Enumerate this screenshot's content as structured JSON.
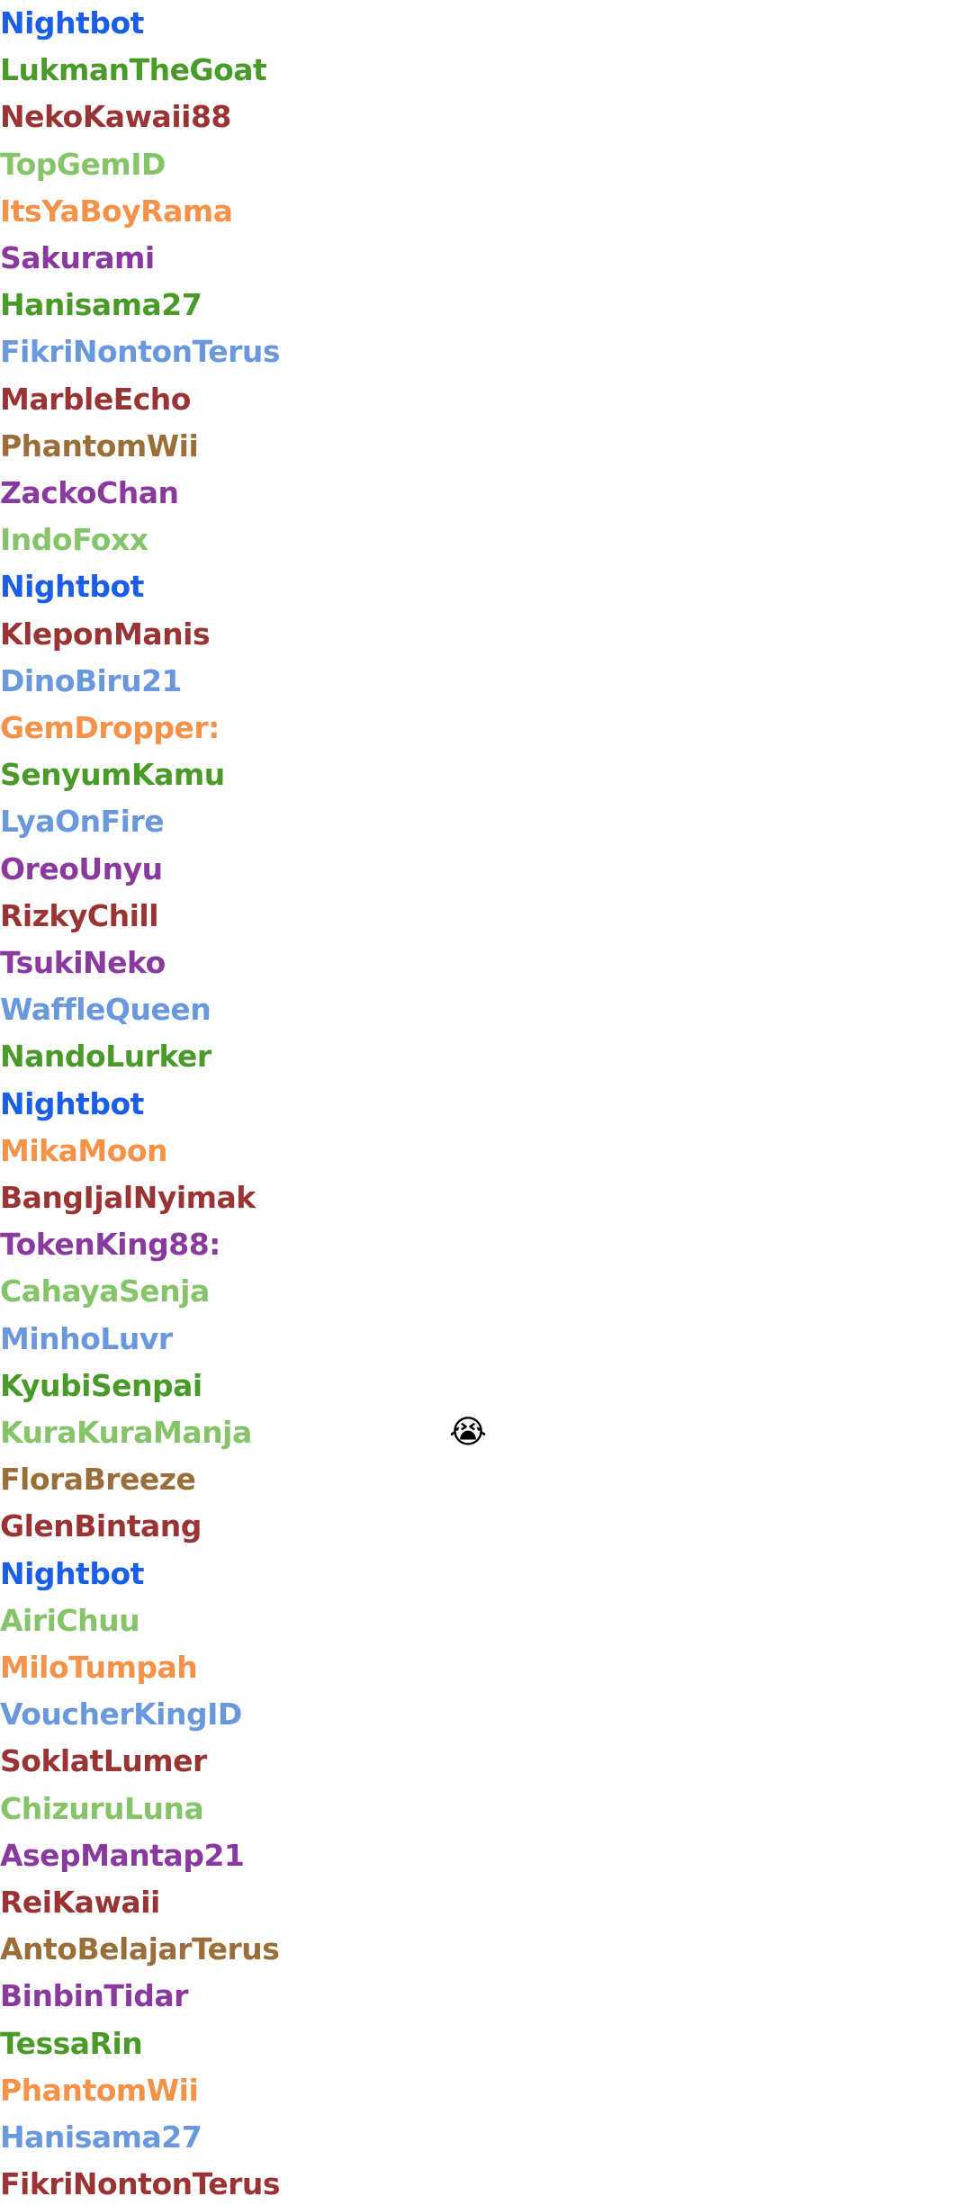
{
  "colors": {
    "nightbot": "#1a5ee8",
    "green": "#4a9a2a",
    "red": "#9a3434",
    "light_green": "#86c46a",
    "orange": "#f5924a",
    "purple": "#8a3a9e",
    "blue": "#6a98dc",
    "brown": "#9a6e38"
  },
  "chat": {
    "rows": [
      {
        "name": "Nightbot",
        "color": "nightbot"
      },
      {
        "name": "LukmanTheGoat",
        "color": "green"
      },
      {
        "name": "NekoKawaii88",
        "color": "red"
      },
      {
        "name": "TopGemID",
        "color": "light_green"
      },
      {
        "name": "ItsYaBoyRama",
        "color": "orange"
      },
      {
        "name": "Sakurami",
        "color": "purple"
      },
      {
        "name": "Hanisama27",
        "color": "green"
      },
      {
        "name": "FikriNontonTerus",
        "color": "blue"
      },
      {
        "name": "MarbleEcho",
        "color": "red"
      },
      {
        "name": "PhantomWii",
        "color": "brown"
      },
      {
        "name": "ZackoChan",
        "color": "purple"
      },
      {
        "name": "IndoFoxx",
        "color": "light_green"
      },
      {
        "name": "Nightbot",
        "color": "nightbot"
      },
      {
        "name": "KleponManis",
        "color": "red"
      },
      {
        "name": "DinoBiru21",
        "color": "blue"
      },
      {
        "name": "GemDropper:",
        "color": "orange"
      },
      {
        "name": "SenyumKamu",
        "color": "green"
      },
      {
        "name": "LyaOnFire",
        "color": "blue"
      },
      {
        "name": "OreoUnyu",
        "color": "purple"
      },
      {
        "name": "RizkyChill",
        "color": "red"
      },
      {
        "name": "TsukiNeko",
        "color": "purple"
      },
      {
        "name": "WaffleQueen",
        "color": "blue"
      },
      {
        "name": "NandoLurker",
        "color": "green"
      },
      {
        "name": "Nightbot",
        "color": "nightbot"
      },
      {
        "name": "MikaMoon",
        "color": "orange"
      },
      {
        "name": "BangIjalNyimak",
        "color": "red"
      },
      {
        "name": "TokenKing88:",
        "color": "purple"
      },
      {
        "name": "CahayaSenja",
        "color": "light_green"
      },
      {
        "name": "MinhoLuvr",
        "color": "blue"
      },
      {
        "name": "KyubiSenpai",
        "color": "green"
      },
      {
        "name": "KuraKuraManja",
        "color": "light_green",
        "emoji": "😭",
        "emoji_icon": "loudly-crying-face-icon"
      },
      {
        "name": "FloraBreeze",
        "color": "brown"
      },
      {
        "name": "GlenBintang",
        "color": "red"
      },
      {
        "name": "Nightbot",
        "color": "nightbot"
      },
      {
        "name": "AiriChuu",
        "color": "light_green"
      },
      {
        "name": "MiloTumpah",
        "color": "orange"
      },
      {
        "name": "VoucherKingID",
        "color": "blue"
      },
      {
        "name": "SoklatLumer",
        "color": "red"
      },
      {
        "name": "ChizuruLuna",
        "color": "light_green"
      },
      {
        "name": "AsepMantap21",
        "color": "purple"
      },
      {
        "name": "ReiKawaii",
        "color": "red"
      },
      {
        "name": "AntoBelajarTerus",
        "color": "brown"
      },
      {
        "name": "BinbinTidar",
        "color": "purple"
      },
      {
        "name": "TessaRin",
        "color": "green"
      },
      {
        "name": "PhantomWii",
        "color": "orange"
      },
      {
        "name": "Hanisama27",
        "color": "blue"
      },
      {
        "name": "FikriNontonTerus",
        "color": "red"
      }
    ]
  }
}
